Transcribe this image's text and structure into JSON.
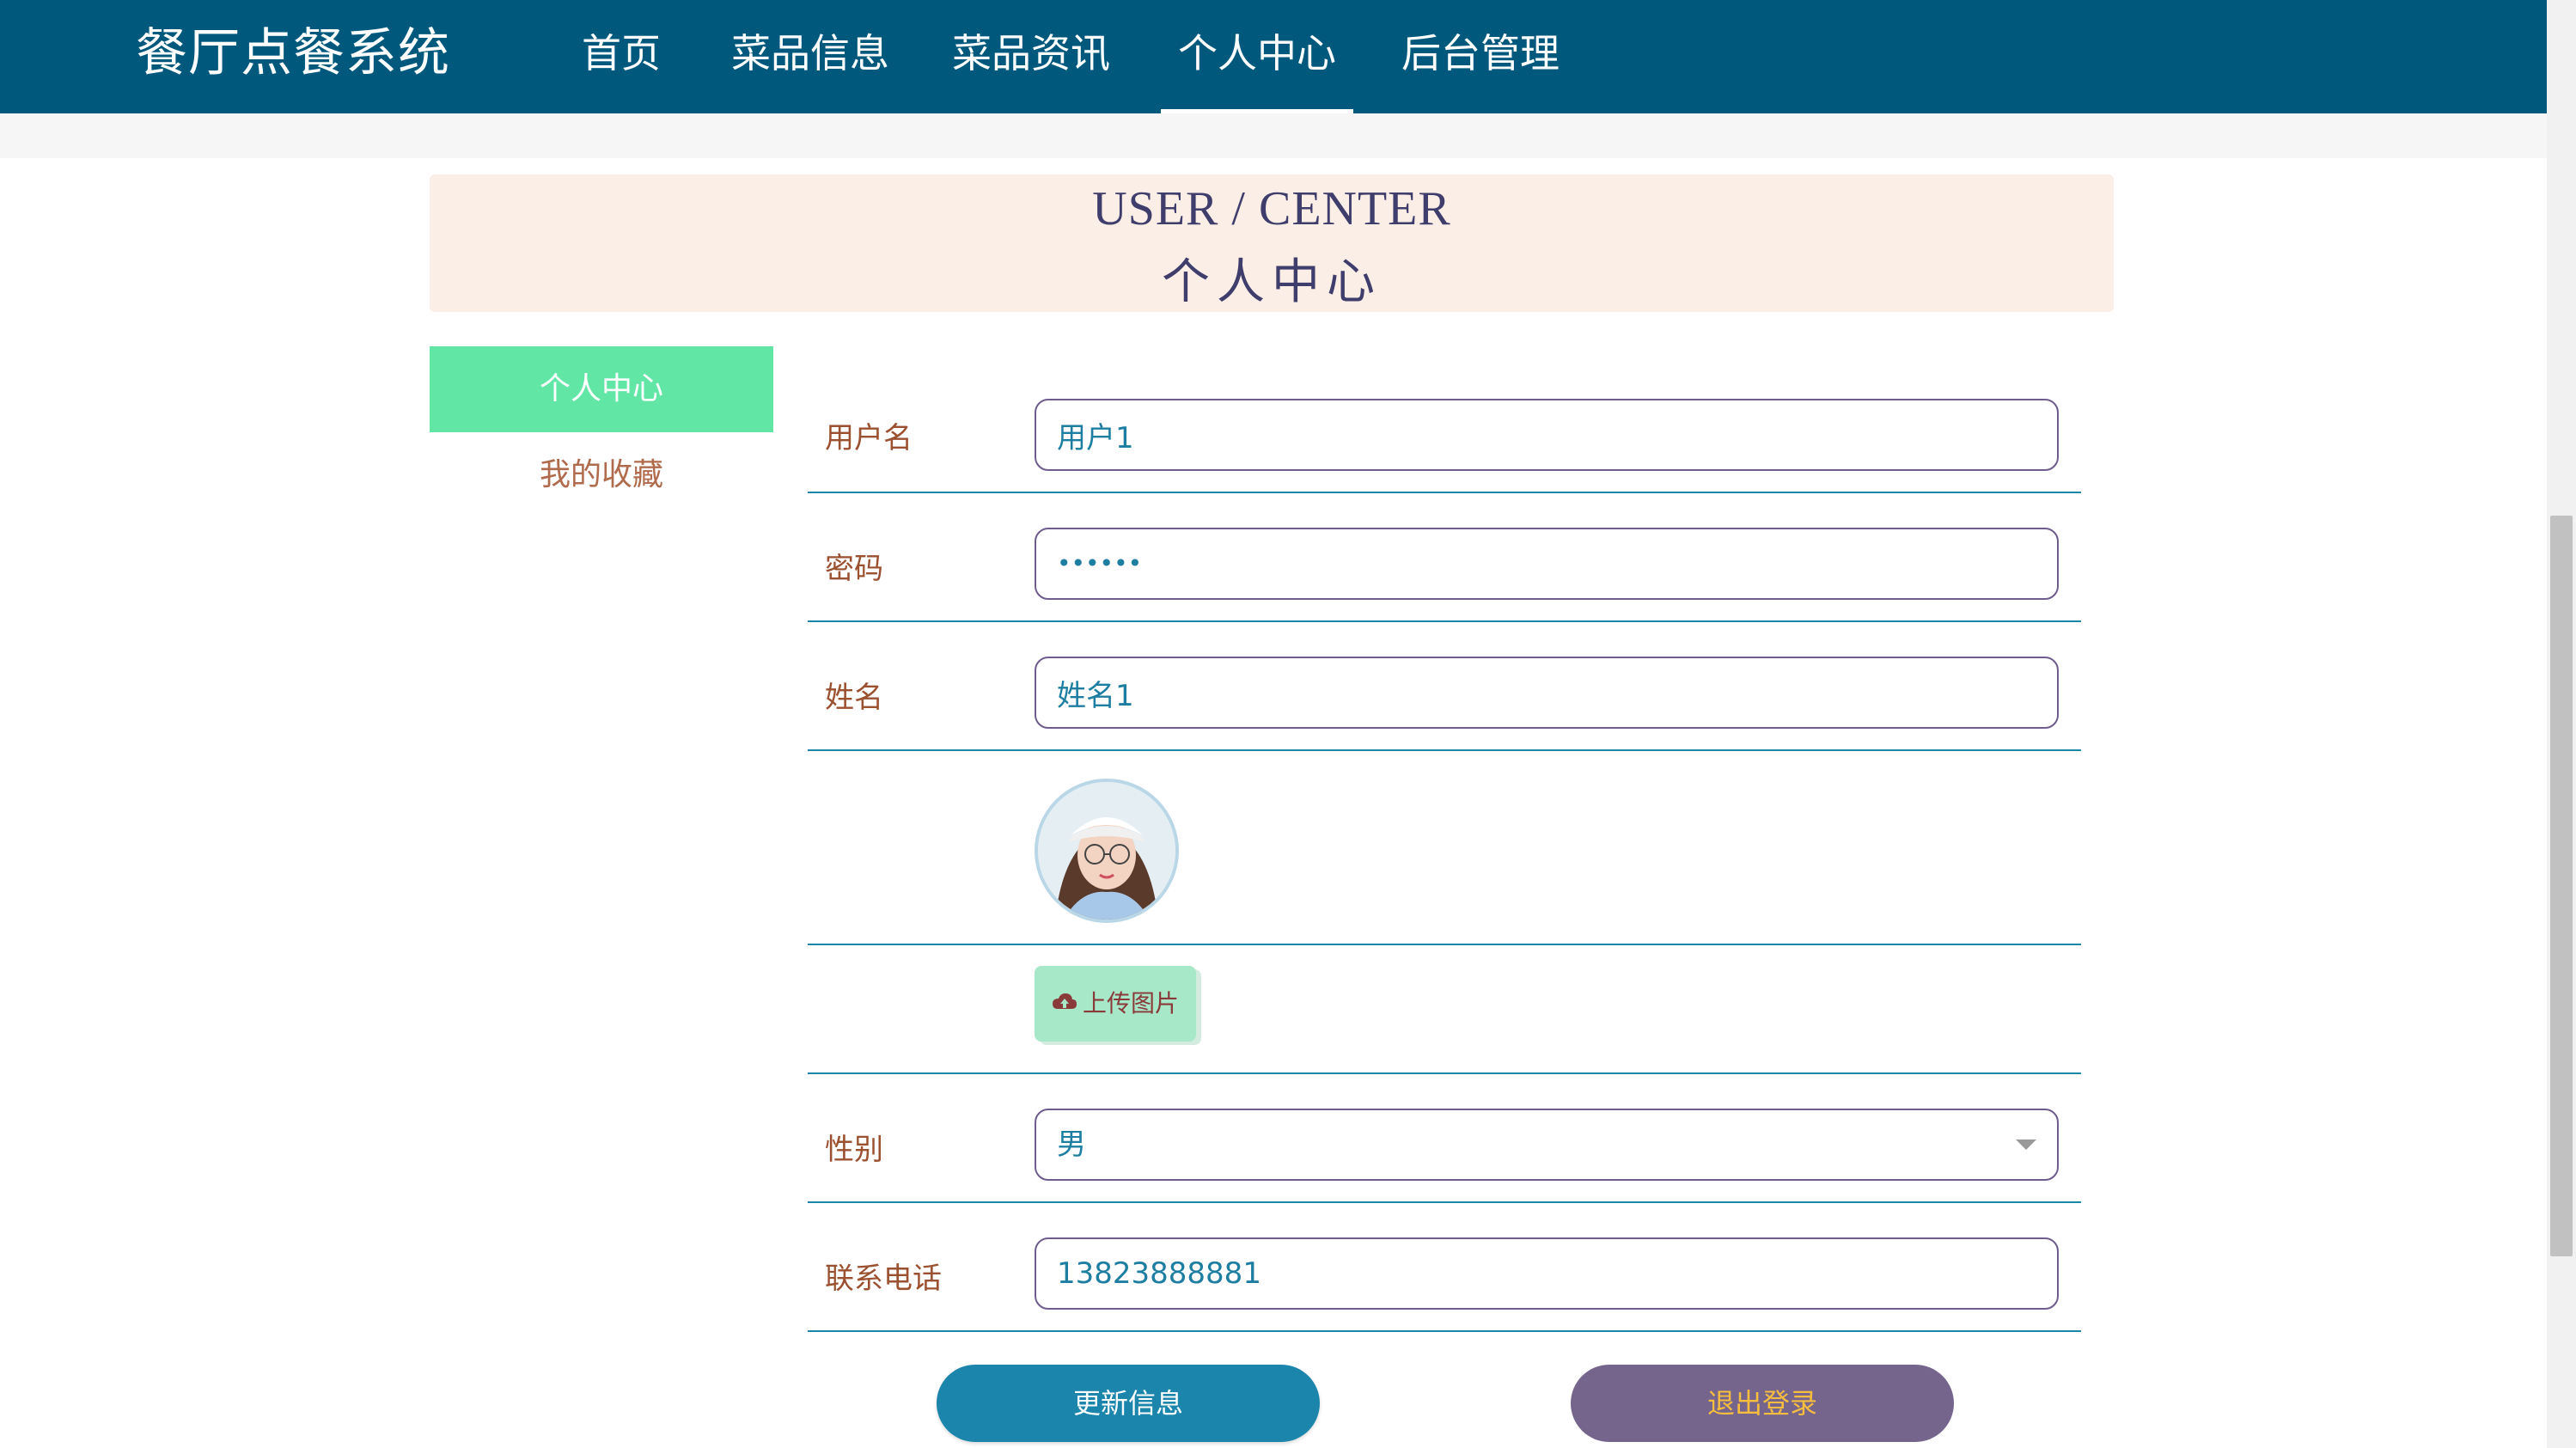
{
  "nav": {
    "brand": "餐厅点餐系统",
    "items": [
      {
        "label": "首页",
        "active": false
      },
      {
        "label": "菜品信息",
        "active": false
      },
      {
        "label": "菜品资讯",
        "active": false
      },
      {
        "label": "个人中心",
        "active": true
      },
      {
        "label": "后台管理",
        "active": false
      }
    ]
  },
  "banner": {
    "title_en": "USER / CENTER",
    "title_cn": "个人中心"
  },
  "sidebar": {
    "items": [
      {
        "label": "个人中心",
        "active": true
      },
      {
        "label": "我的收藏",
        "active": false
      }
    ]
  },
  "form": {
    "username": {
      "label": "用户名",
      "value": "用户1"
    },
    "password": {
      "label": "密码",
      "value": "••••••"
    },
    "name": {
      "label": "姓名",
      "value": "姓名1"
    },
    "upload_label": "上传图片",
    "gender": {
      "label": "性别",
      "value": "男"
    },
    "phone": {
      "label": "联系电话",
      "value": "13823888881"
    }
  },
  "buttons": {
    "update": "更新信息",
    "logout": "退出登录"
  },
  "colors": {
    "nav_bg": "#00597d",
    "accent_green": "#62e6a6",
    "label_brown": "#9b5030",
    "input_text": "#1e7ea2",
    "update_btn": "#1b85ab",
    "logout_btn": "#75648c",
    "logout_text": "#f6bd3e"
  },
  "icons": {
    "upload": "cloud-upload-icon",
    "select": "chevron-down-icon"
  }
}
